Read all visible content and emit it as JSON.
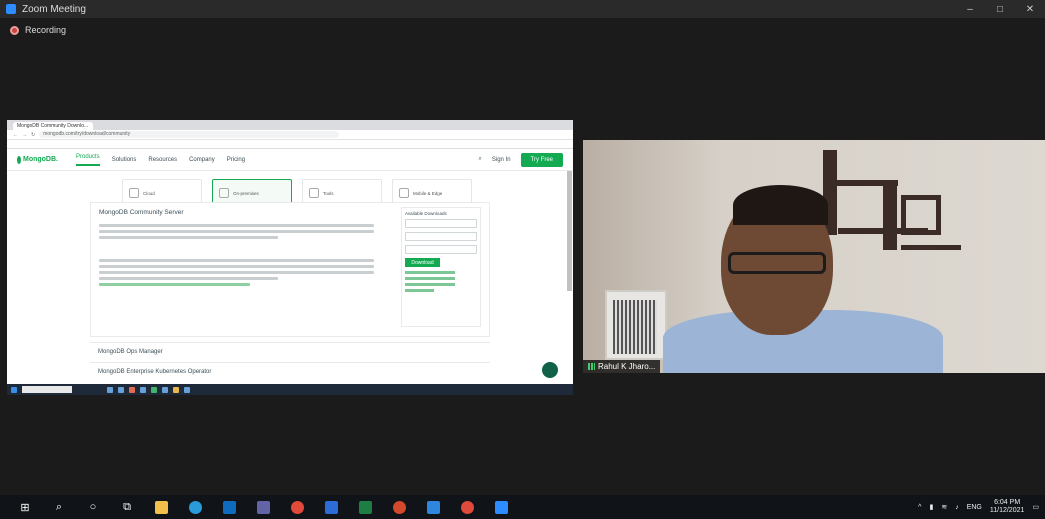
{
  "zoom": {
    "title": "Zoom Meeting",
    "recording_label": "Recording",
    "window_controls": [
      "–",
      "□",
      "✕"
    ],
    "participant_name": "Rahul K Jharo..."
  },
  "browser": {
    "tab_title": "MongoDB Community Downlo...",
    "url": "mongodb.com/try/download/community"
  },
  "mongodb": {
    "logo": "MongoDB.",
    "nav": [
      "Products",
      "Solutions",
      "Resources",
      "Company",
      "Pricing"
    ],
    "sign_in": "Sign In",
    "try_free": "Try Free",
    "product_cards": [
      "Cloud",
      "On-premises",
      "Tools",
      "Mobile & Edge"
    ],
    "panel_title": "MongoDB Community Server",
    "downloads_title": "Available Downloads",
    "download_button": "Download",
    "sections": [
      "MongoDB Ops Manager",
      "MongoDB Enterprise Kubernetes Operator"
    ]
  },
  "taskbar": {
    "icons": [
      "windows-icon",
      "search-icon",
      "cortana-icon",
      "task-view-icon",
      "file-explorer-icon",
      "edge-icon",
      "outlook-icon",
      "teams-icon",
      "chrome-icon",
      "word-icon",
      "excel-icon",
      "powerpoint-icon",
      "onedrive-icon",
      "chrome-icon-2",
      "zoom-icon"
    ],
    "language": "ENG",
    "time": "6:04 PM",
    "date": "11/12/2021"
  },
  "colors": {
    "mongodb_green": "#13aa52",
    "zoom_blue": "#2d8cff",
    "recording_red": "#c9453f"
  }
}
